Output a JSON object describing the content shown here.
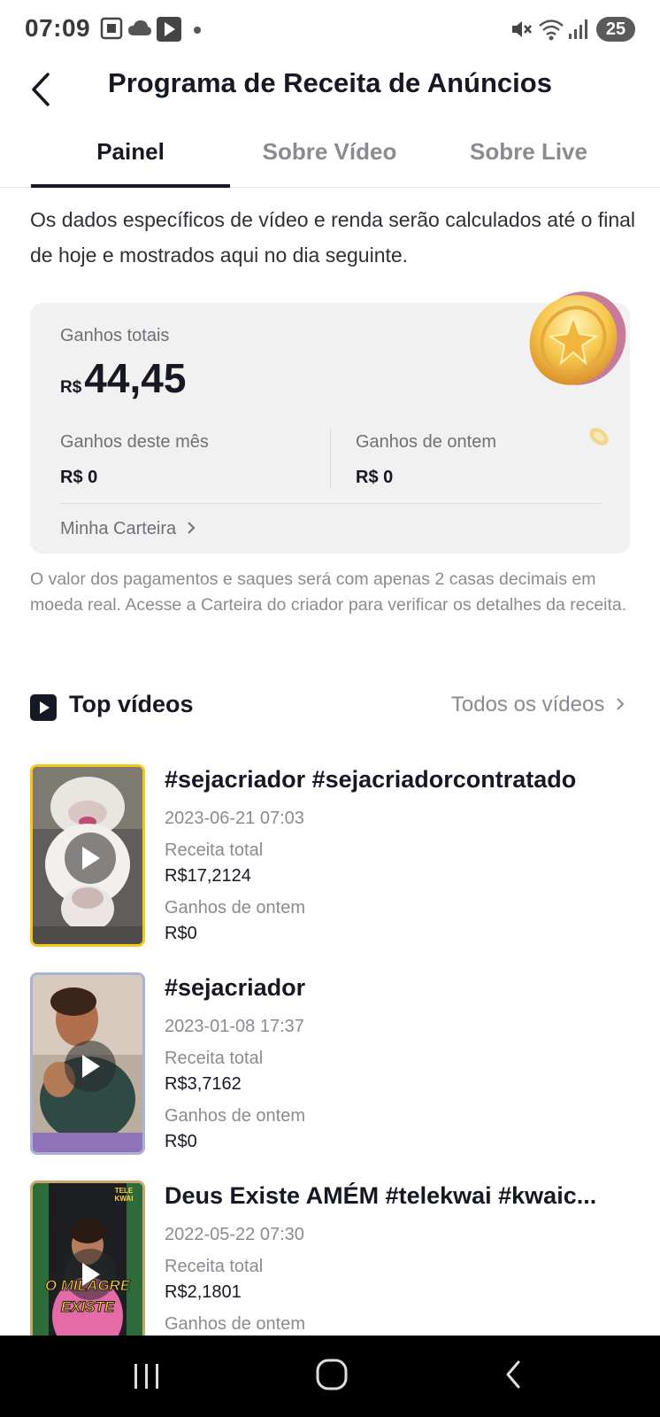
{
  "status_bar": {
    "time": "07:09",
    "battery": "25",
    "icons": [
      "screenshot-icon",
      "cloud-icon",
      "play-store-icon",
      "dot-icon",
      "mute-icon",
      "wifi-icon",
      "signal-icon"
    ]
  },
  "header": {
    "title": "Programa de Receita de Anúncios",
    "back_icon": "back-arrow-icon"
  },
  "tabs": [
    {
      "label": "Painel",
      "active": true
    },
    {
      "label": "Sobre Vídeo",
      "active": false
    },
    {
      "label": "Sobre Live",
      "active": false
    }
  ],
  "notice": "Os dados específicos de vídeo e renda serão calculados até o final de hoje e mostrados aqui no dia seguinte.",
  "earnings": {
    "total_label": "Ganhos totais",
    "total_currency": "R$",
    "total_value": "44,45",
    "month_label": "Ganhos deste mês",
    "month_value": "R$ 0",
    "yesterday_label": "Ganhos de ontem",
    "yesterday_value": "R$ 0",
    "wallet_link": "Minha Carteira",
    "coin_icon": "gold-coin-icon"
  },
  "info": "O valor dos pagamentos e saques será com apenas 2 casas decimais em moeda real. Acesse a Carteira do criador para verificar os detalhes da receita.",
  "top_videos": {
    "title": "Top vídeos",
    "all_link": "Todos os vídeos",
    "items": [
      {
        "title": "#sejacriador #sejacriadorcontratado",
        "date": "2023-06-21 07:03",
        "revenue_label": "Receita total",
        "revenue": "R$17,2124",
        "yesterday_label": "Ganhos de ontem",
        "yesterday": "R$0",
        "border_color": "#f5c518"
      },
      {
        "title": "#sejacriador",
        "date": "2023-01-08 17:37",
        "revenue_label": "Receita total",
        "revenue": "R$3,7162",
        "yesterday_label": "Ganhos de ontem",
        "yesterday": "R$0",
        "border_color": "#a9b3d6"
      },
      {
        "title": "Deus Existe AMÉM #telekwai #kwaic...",
        "date": "2022-05-22 07:30",
        "revenue_label": "Receita total",
        "revenue": "R$2,1801",
        "yesterday_label": "Ganhos de ontem",
        "yesterday": "",
        "thumb_text_1": "O MILAGRE",
        "thumb_text_2": "EXISTE",
        "thumb_badge": "TELE KWAI"
      }
    ]
  },
  "nav_bar": {
    "icons": [
      "recent-apps-icon",
      "home-icon",
      "back-icon"
    ]
  }
}
